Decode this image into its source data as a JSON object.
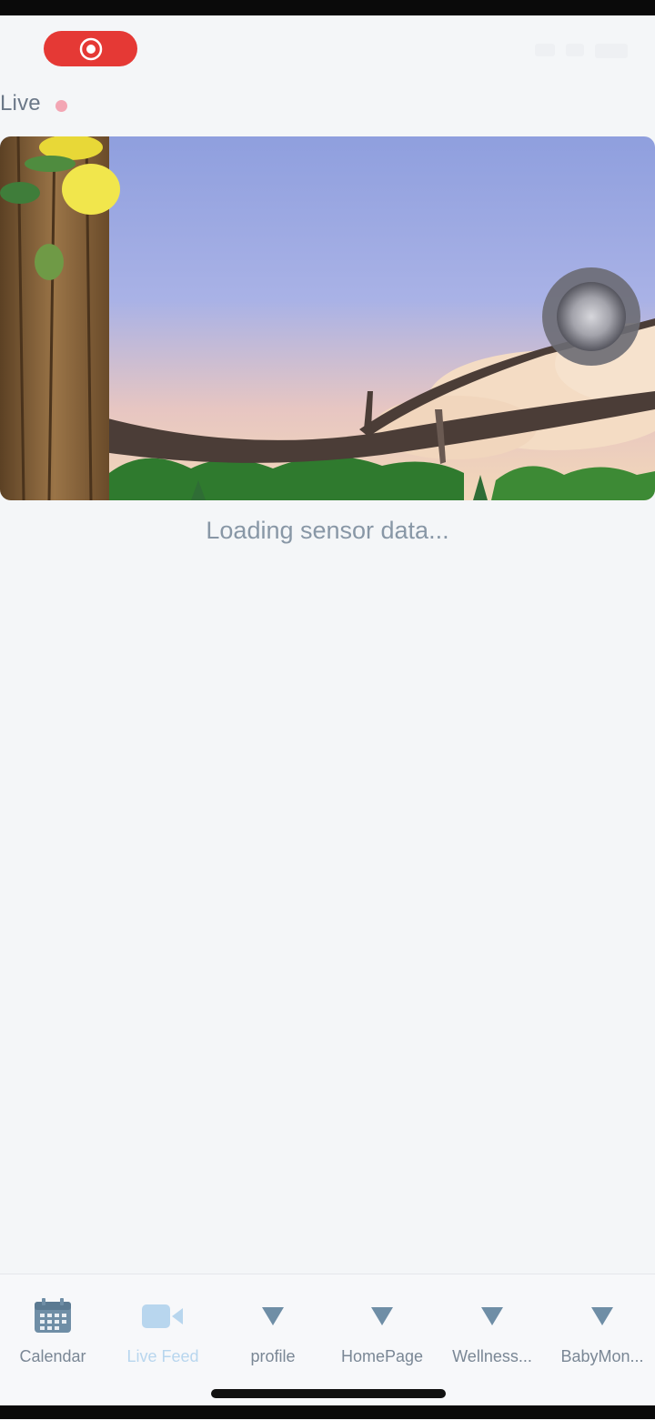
{
  "status_bar": {
    "recording_icon": "screen-record-icon",
    "recording_color": "#e53935"
  },
  "live": {
    "label": "Live",
    "dot_color": "#f3a6b4"
  },
  "video": {
    "content": "cartoon-tree-branch-scene",
    "overlay_icon": "touch-indicator-icon"
  },
  "loading_text": "Loading sensor data...",
  "tabs": [
    {
      "label": "Calendar",
      "icon": "calendar-icon",
      "active": false
    },
    {
      "label": "Live Feed",
      "icon": "video-camera-icon",
      "active": true
    },
    {
      "label": "profile",
      "icon": "triangle-down-icon",
      "active": false
    },
    {
      "label": "HomePage",
      "icon": "triangle-down-icon",
      "active": false
    },
    {
      "label": "Wellness...",
      "icon": "triangle-down-icon",
      "active": false
    },
    {
      "label": "BabyMon...",
      "icon": "triangle-down-icon",
      "active": false
    }
  ],
  "colors": {
    "background": "#f4f6f8",
    "tab_active": "#b8d6ee",
    "tab_inactive": "#7a8795",
    "icon": "#6f8ea6"
  }
}
